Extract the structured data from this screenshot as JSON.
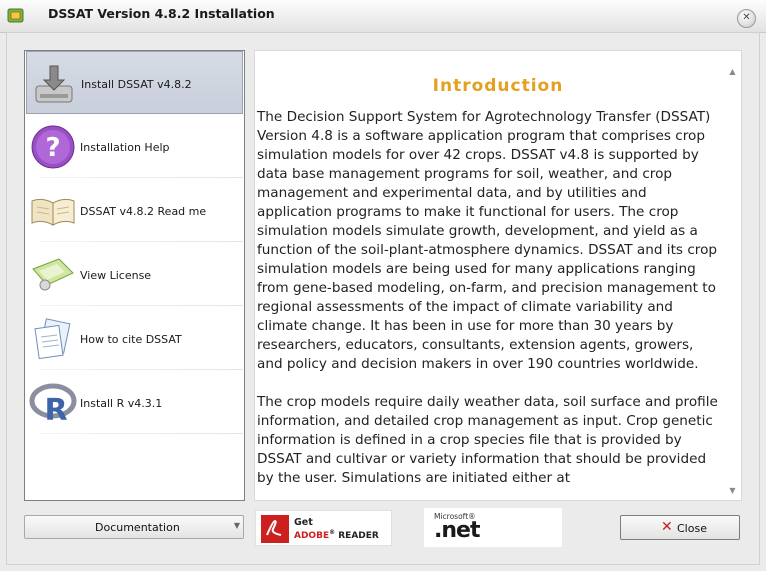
{
  "window": {
    "title": "DSSAT Version 4.8.2 Installation",
    "close_glyph": "✕"
  },
  "sidebar": {
    "items": [
      {
        "label": "Install DSSAT v4.8.2",
        "icon": "install-disk-icon",
        "selected": true
      },
      {
        "label": "Installation Help",
        "icon": "help-question-icon"
      },
      {
        "label": "DSSAT v4.8.2 Read me",
        "icon": "open-book-icon"
      },
      {
        "label": "View License",
        "icon": "license-certificate-icon"
      },
      {
        "label": "How to cite DSSAT",
        "icon": "documents-icon"
      },
      {
        "label": "Install R v4.3.1",
        "icon": "r-logo-icon"
      }
    ]
  },
  "content": {
    "title": "Introduction",
    "paragraphs": [
      "The Decision Support System for Agrotechnology Transfer (DSSAT) Version 4.8 is a software application program that comprises crop simulation models for over 42 crops. DSSAT v4.8 is supported by data base management programs for soil, weather, and crop management and experimental data, and by utilities and application programs to make it functional for users. The crop simulation models simulate growth, development, and yield as a function of the soil-plant-atmosphere dynamics. DSSAT and its crop simulation models are being used for many applications ranging from gene-based modeling, on-farm, and precision management to regional assessments of the impact of climate variability and climate change. It has been in use for more than 30 years by researchers, educators, consultants, extension agents, growers, and policy and decision makers in over 190 countries worldwide.",
      "The crop models require daily weather data, soil surface and profile information, and detailed crop management as input. Crop genetic information is defined in a crop species file that is provided by DSSAT and cultivar or variety information that should be provided by the user. Simulations are initiated either at"
    ]
  },
  "footer": {
    "documentation_label": "Documentation",
    "adobe_get": "Get",
    "adobe_brand": "ADOBE",
    "adobe_reg": "®",
    "adobe_product": "READER",
    "microsoft_label": "Microsoft®",
    "net_label": ".net",
    "close_label": "Close"
  },
  "colors": {
    "accent_title": "#e5a020",
    "close_x": "#c22020"
  }
}
